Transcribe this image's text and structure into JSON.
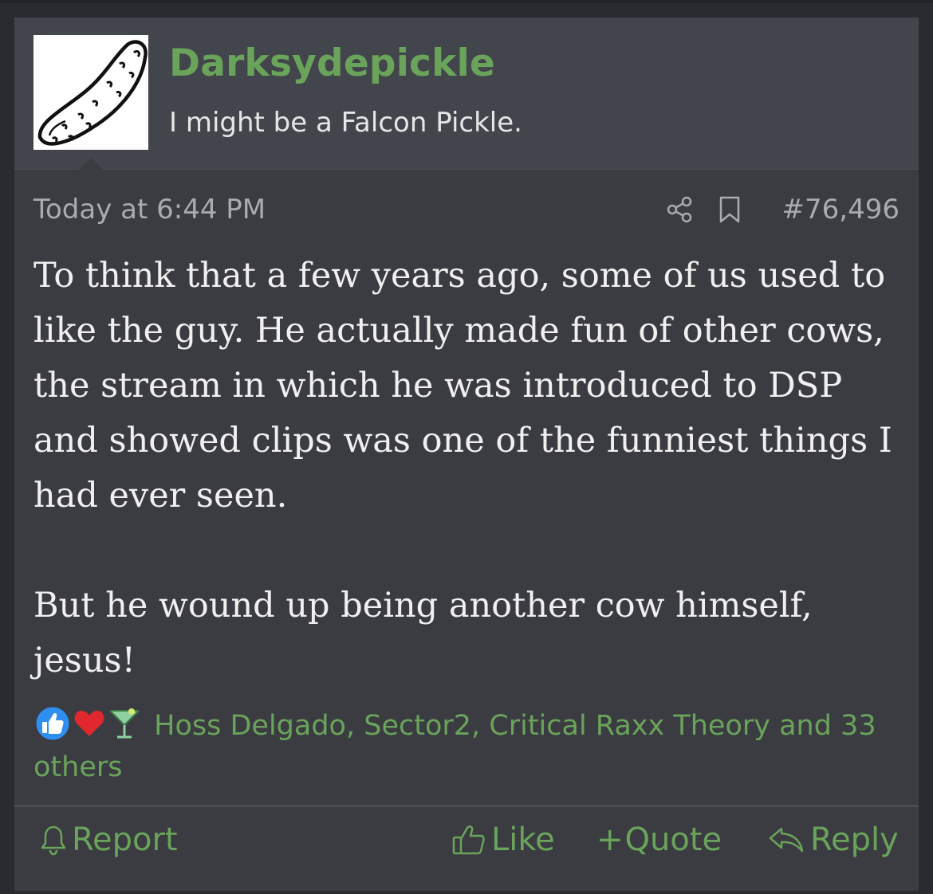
{
  "post": {
    "username": "Darksydepickle",
    "user_title": "I might be a Falcon Pickle.",
    "timestamp": "Today at 6:44 PM",
    "post_number": "#76,496",
    "message": {
      "paragraph1": "To think that a few years ago, some of us used to like the guy. He actually made fun of other cows, the stream in which he was introduced to DSP and showed clips was one of the funniest things I had ever seen.",
      "paragraph2": "But he wound up being another cow himself, jesus!"
    },
    "reactions": {
      "icons": [
        "like-icon",
        "love-icon",
        "cocktail-icon"
      ],
      "text": "Hoss Delgado, Sector2, Critical Raxx Theory and 33 others"
    },
    "actions": {
      "report": "Report",
      "like": "Like",
      "quote": "Quote",
      "quote_prefix": "+",
      "reply": "Reply"
    }
  },
  "colors": {
    "accent": "#6aa35a",
    "background": "#3a3c42",
    "header": "#43454c",
    "text": "#f0f0f0",
    "muted": "#a9abb0"
  }
}
